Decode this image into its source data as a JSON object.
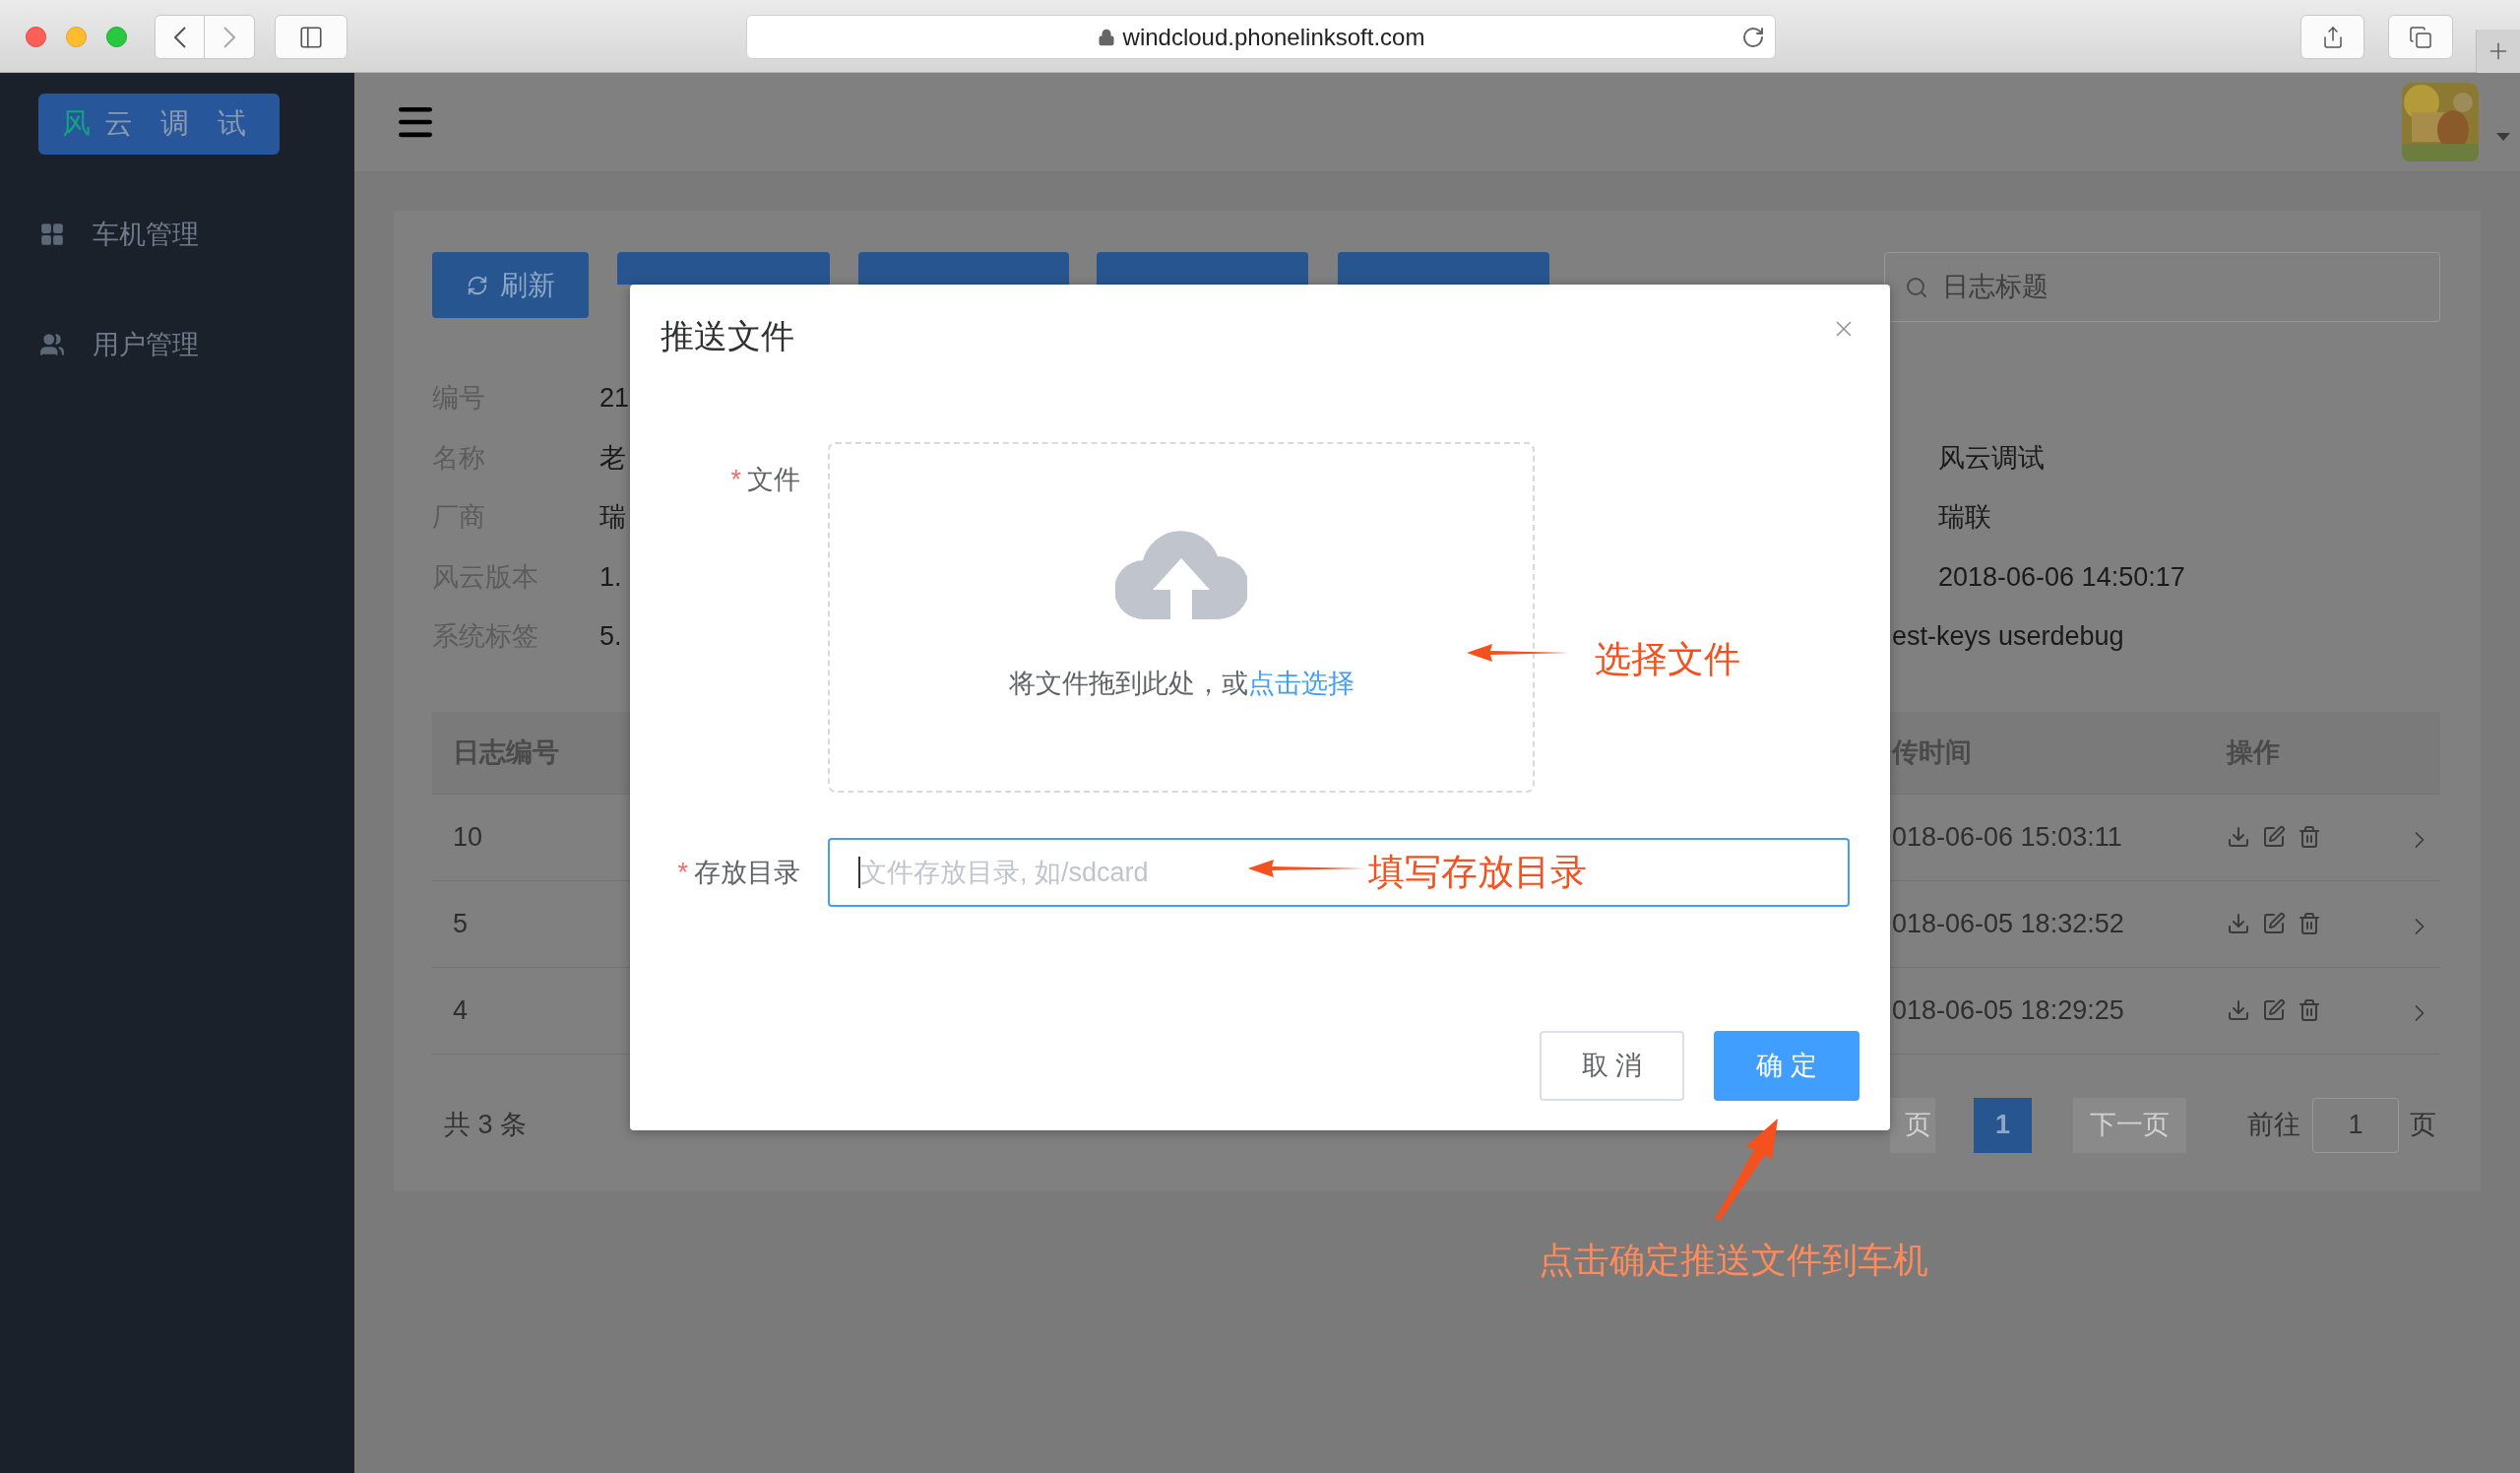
{
  "browser": {
    "url": "windcloud.phonelinksoft.com"
  },
  "sidebar": {
    "logo": {
      "accent": "风",
      "rest": "云 调 试"
    },
    "items": [
      {
        "label": "车机管理",
        "selected": false
      },
      {
        "label": "用户管理",
        "selected": false
      }
    ]
  },
  "toolbar": {
    "refresh": "刷新",
    "search_placeholder": "日志标题"
  },
  "info": [
    {
      "label": "编号",
      "value": "21"
    },
    {
      "label": "名称",
      "value": "老",
      "right_value": "风云调试"
    },
    {
      "label": "厂商",
      "value": "瑞",
      "right_value": "瑞联"
    },
    {
      "label": "风云版本",
      "value": "1.",
      "right_value": "2018-06-06 14:50:17"
    },
    {
      "label": "系统标签",
      "value": "5.",
      "continued": "est-keys userdebug"
    }
  ],
  "table": {
    "columns": [
      "日志编号",
      "传时间",
      "操作"
    ],
    "rows": [
      {
        "id": "10",
        "time": "018-06-06 15:03:11"
      },
      {
        "id": "5",
        "time": "018-06-05 18:32:52"
      },
      {
        "id": "4",
        "time": "018-06-05 18:29:25"
      }
    ]
  },
  "footer": {
    "total": "共 3 条",
    "prev": "页",
    "pages": [
      {
        "label": "1",
        "selected": true
      }
    ],
    "next": "下一页",
    "goto": "前往",
    "goto_value": "1",
    "goto_suffix": "页"
  },
  "dialog": {
    "title": "推送文件",
    "fields": [
      {
        "kind": "upload",
        "label": "文件",
        "marker": "*",
        "hint": "将文件拖到此处，或",
        "link": "点击选择"
      },
      {
        "kind": "input",
        "label": "存放目录",
        "marker": "*",
        "placeholder": "文件存放目录, 如/sdcard",
        "focused": true
      }
    ],
    "cancel": "取 消",
    "confirm": "确 定"
  },
  "annotations": [
    {
      "text": "选择文件"
    },
    {
      "text": "填写存放目录"
    },
    {
      "text": "点击确定推送文件到车机"
    }
  ]
}
